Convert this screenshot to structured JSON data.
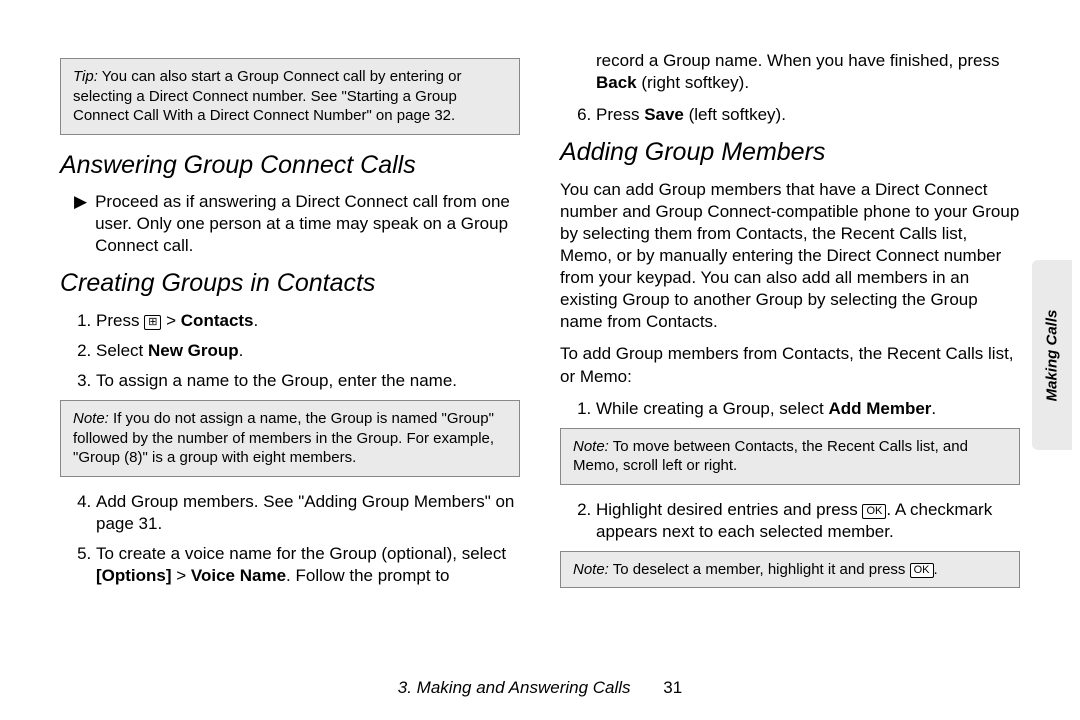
{
  "tipbox": {
    "lead": "Tip:",
    "text": "You can also start a Group Connect call by entering or selecting a Direct Connect number. See \"Starting a Group Connect Call With a Direct Connect Number\" on page 32."
  },
  "sec1": {
    "title": "Answering Group Connect Calls",
    "bullet": "Proceed as if answering a Direct Connect call from one user. Only one person at a time may speak on a Group Connect call."
  },
  "sec2": {
    "title": "Creating Groups in Contacts",
    "step1_a": "Press ",
    "step1_b": " > ",
    "step1_c": "Contacts",
    "step1_d": ".",
    "step2_a": "Select ",
    "step2_b": "New Group",
    "step2_c": ".",
    "step3": "To assign a name to the Group, enter the name.",
    "note_lead": "Note:",
    "note_text": "If you do not assign a name, the Group is named \"Group\" followed by the number of members in the Group. For example, \"Group (8)\" is a group with eight members.",
    "step4": "Add Group members. See \"Adding Group Members\" on page 31.",
    "step5_a": "To create a voice name for the Group (optional), select ",
    "step5_b": "[Options]",
    "step5_c": " > ",
    "step5_d": "Voice Name",
    "step5_e": ". Follow the prompt to"
  },
  "col2top": {
    "line1_a": "record a Group name. When you have finished, press ",
    "line1_b": "Back",
    "line1_c": " (right softkey).",
    "step6_a": "Press ",
    "step6_b": "Save",
    "step6_c": " (left softkey)."
  },
  "sec3": {
    "title": "Adding Group Members",
    "para": "You can add Group members that have a Direct Connect number and Group Connect-compatible phone to your Group by selecting them from Contacts, the Recent Calls list, Memo, or by manually entering the Direct Connect number from your keypad. You can also add all members in an existing Group to another Group by selecting the Group name from Contacts.",
    "lead": "To add Group members from Contacts, the Recent Calls list, or Memo:",
    "step1_a": "While creating a Group, select ",
    "step1_b": "Add Member",
    "step1_c": ".",
    "note1_lead": "Note:",
    "note1_text": "To move between Contacts, the Recent Calls list, and Memo, scroll left or right.",
    "step2_a": "Highlight desired entries and press ",
    "step2_b": ". A checkmark appears next to each selected member.",
    "note2_lead": "Note:",
    "note2_text_a": "To deselect a member, highlight it and press ",
    "note2_text_b": "."
  },
  "key_ok": "OK",
  "key_menu": "⊞",
  "footer": {
    "chapter": "3. Making and Answering Calls",
    "page": "31"
  },
  "sidetab": "Making Calls"
}
